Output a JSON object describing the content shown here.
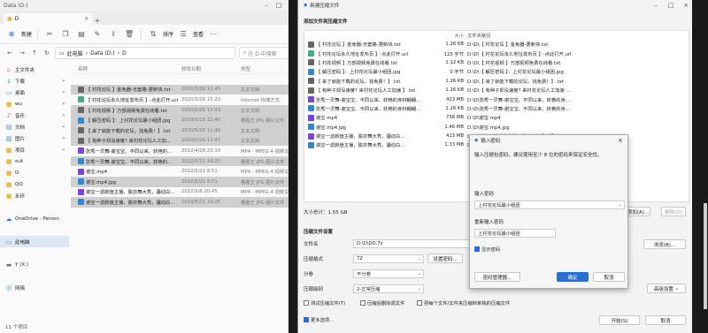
{
  "explorer": {
    "window_title": "Data (D:)",
    "tab_label": "D",
    "cmd": {
      "new": "新建",
      "sort": "排序",
      "view": "查看"
    },
    "address": {
      "parts": [
        "此电脑",
        "Data (D:)",
        "D"
      ],
      "search_placeholder": "在 D 中搜索"
    },
    "columns": {
      "name": "名称",
      "date": "修改日期",
      "type": "类型"
    },
    "nav": [
      {
        "label": "主文件夹",
        "icon": "home-icon",
        "sel": false,
        "indent": false,
        "pin": false
      },
      {
        "label": "下载",
        "icon": "download-icon",
        "sel": false,
        "indent": false,
        "pin": true
      },
      {
        "label": "桌面",
        "icon": "desktop-icon",
        "sel": false,
        "indent": false,
        "pin": true
      },
      {
        "label": "wu",
        "icon": "folder-icon",
        "sel": false,
        "indent": false,
        "pin": true
      },
      {
        "label": "音乐",
        "icon": "music-icon",
        "sel": false,
        "indent": false,
        "pin": true
      },
      {
        "label": "文档",
        "icon": "document-icon",
        "sel": false,
        "indent": false,
        "pin": true
      },
      {
        "label": "图片",
        "icon": "picture-icon",
        "sel": false,
        "indent": false,
        "pin": true
      },
      {
        "label": "项目",
        "icon": "folder-icon",
        "sel": false,
        "indent": false,
        "pin": true
      },
      {
        "label": "out",
        "icon": "folder-icon",
        "sel": false,
        "indent": false,
        "pin": false
      },
      {
        "label": "D",
        "icon": "folder-icon",
        "sel": false,
        "indent": false,
        "pin": false
      },
      {
        "label": "QQ",
        "icon": "folder-icon",
        "sel": false,
        "indent": false,
        "pin": false
      },
      {
        "label": "永环",
        "icon": "folder-icon",
        "sel": false,
        "indent": false,
        "pin": false
      },
      {
        "label": "",
        "icon": "",
        "sel": false,
        "indent": false,
        "pin": false
      },
      {
        "label": "OneDrive - Person",
        "icon": "cloud-icon",
        "sel": false,
        "indent": false,
        "pin": false
      },
      {
        "label": "",
        "icon": "",
        "sel": false,
        "indent": false,
        "pin": false
      },
      {
        "label": "此电脑",
        "icon": "computer-icon",
        "sel": true,
        "indent": false,
        "pin": false
      },
      {
        "label": "",
        "icon": "",
        "sel": false,
        "indent": false,
        "pin": false
      },
      {
        "label": "Y (X:)",
        "icon": "drive-icon",
        "sel": false,
        "indent": false,
        "pin": false
      },
      {
        "label": "",
        "icon": "",
        "sel": false,
        "indent": false,
        "pin": false
      },
      {
        "label": "网络",
        "icon": "network-icon",
        "sel": false,
        "indent": false,
        "pin": false
      }
    ],
    "files": [
      {
        "name": "",
        "date": "",
        "type": "",
        "color": "",
        "sel": false
      },
      {
        "name": "【 村花论坛 】金免器-无套路-更新快.txt",
        "date": "2020/5/26 11:45",
        "type": "文本文档",
        "color": "#666",
        "sel": true
      },
      {
        "name": "【 村花论坛永久地址发布页 】-点此打开.url",
        "date": "2020/5/26 15:23",
        "type": "Internet 快捷方式",
        "color": "#4a8",
        "sel": false
      },
      {
        "name": "【 村花视频 】万部视频免费在线看.txt",
        "date": "2020/5/26 11:43",
        "type": "文本文档",
        "color": "#666",
        "sel": true
      },
      {
        "name": "【 解压密码 】：上村花论坛最小组团.jpg",
        "date": "2019/5/15 22:46",
        "type": "看图王 JPG 图片文件",
        "color": "#38c",
        "sel": true
      },
      {
        "name": "【 来了就能下载的论坛，找免费！】.txt",
        "date": "2020/5/26 11:46",
        "type": "文本文档",
        "color": "#666",
        "sel": true
      },
      {
        "name": "【 有种子却没速度? 来村花论坛人工加...",
        "date": "2020/5/26 11:47",
        "type": "文本文档",
        "color": "#666",
        "sel": true
      },
      {
        "name": "张秀一灵舞-谢宝宝、不同以来、妖艳的...",
        "date": "2022/4/28 22:10",
        "type": "MP4 - MPEG-4 视频文件",
        "color": "#74d",
        "sel": false
      },
      {
        "name": "张秀一灵舞-谢宝宝、不同以来、妖艳的...",
        "date": "2022/5/21 16:25",
        "type": "看图王 JPG 图片文件",
        "color": "#38c",
        "sel": true
      },
      {
        "name": "谢宝.mp4",
        "date": "2022/5/21 8:51",
        "type": "MP4 - MPEG-4 视频文件",
        "color": "#74d",
        "sel": false
      },
      {
        "name": "谢宝.mp4.jpg",
        "date": "2022/5/21 8:51",
        "type": "看图王 JPG 图片文件",
        "color": "#38c",
        "sel": true
      },
      {
        "name": "谢宝一滤颜值主播，脱衣舞大秀，骚动白...",
        "date": "2022/5/8 20:45",
        "type": "MP4 - MPEG-4 视频文件",
        "color": "#74d",
        "sel": false
      },
      {
        "name": "谢宝一滤颜值主播，脱衣舞大秀，骚动白...",
        "date": "2022/5/21 16:25",
        "type": "看图王 JPG 图片文件",
        "color": "#38c",
        "sel": true
      }
    ],
    "status": "11 个项目"
  },
  "archive": {
    "window_title": "新建压缩文件",
    "section_add": "添加文件到压缩文件",
    "columns": {
      "name": "",
      "size": "大小",
      "path": "文件夹路径"
    },
    "files": [
      {
        "name": "【 村花论坛 】金免器-无套路-更新快.txt",
        "size": "1.26 KB",
        "path": "D:\\D\\【 村花论坛 】金免器-更新快.txt",
        "color": "#666"
      },
      {
        "name": "【 村花论坛永久地址发布页 】-点此打开.url",
        "size": "123 字节",
        "path": "D:\\D\\【 村花论坛永久地址发布页 】-点此打开.url",
        "color": "#4a8"
      },
      {
        "name": "【 村花视频 】万部视频免费在线看.txt",
        "size": "1.12 KB",
        "path": "D:\\D\\【 村花视频 】万部视频免费在线看.txt",
        "color": "#666"
      },
      {
        "name": "【 解压密码 】：上村花论坛最小组团.jpg",
        "size": "0 字节",
        "path": "D:\\D\\【 解压密码 】：上村花论坛最小组团.jpg",
        "color": "#38c"
      },
      {
        "name": "【 来了就能下载的论坛，找免费！】.txt",
        "size": "1.26 KB",
        "path": "D:\\D\\【 来了就能下载的论坛，找免费！】.txt",
        "color": "#666"
      },
      {
        "name": "【 有种子却没速度? 来村花论坛人工加速 】.txt",
        "size": "1.26 KB",
        "path": "D:\\D\\【 有种子却没速度? 来村花论坛人工加速 】.txt",
        "color": "#666"
      },
      {
        "name": "张秀一灵舞-谢宝宝、不同以来、妖艳的身材翩翩...",
        "size": "413 MB",
        "path": "D:\\D\\张秀一灵舞-谢宝宝、不同以来、妖艳的身材翩翩...",
        "color": "#74d"
      },
      {
        "name": "张秀一灵舞-谢宝宝、不同以来、妖艳的身材翩翩...",
        "size": "1.26 KB",
        "path": "D:\\D\\张秀一灵舞-谢宝宝、不同以来、妖艳的身材...",
        "color": "#38c"
      },
      {
        "name": "谢宝.mp4",
        "size": "736 MB",
        "path": "D:\\D\\谢宝.mp4",
        "color": "#74d"
      },
      {
        "name": "谢宝.mp4.jpg",
        "size": "1.46 MB",
        "path": "D:\\D\\谢宝.mp4.jpg",
        "color": "#38c"
      },
      {
        "name": "谢宝一滤颜值主播，脱衣舞大秀，骚动白...",
        "size": "413 MB",
        "path": "D:\\D\\谢宝一滤颜值主播，脱衣舞大秀，骚动白...",
        "color": "#74d"
      },
      {
        "name": "谢宝一滤颜值主播，脱衣舞大秀，骚动白...",
        "size": "1.33 MB",
        "path": "D:\\D\\谢宝一滤颜值主播，脱衣舞大秀，骚动白...",
        "color": "#38c"
      }
    ],
    "total_size": "大小总计：1.55 GB",
    "add_button": "添加(A)...",
    "delete_button": "删除(D)",
    "section_settings": "压缩文件设置",
    "filename_label": "文件名",
    "filename_value": "D:\\D\\DD.7z",
    "browse_button": "浏览(B)...",
    "format_label": "压缩格式",
    "format_value": "7Z",
    "set_password_button": "设置密码...",
    "split_label": "分卷",
    "split_value": "不分卷",
    "level_label": "压缩级别",
    "level_value": "2-正常压缩",
    "advanced_button": "高级设置",
    "options": [
      "测试压缩文件(T)",
      "压缩后删除源文件",
      "把每个文件/文件夹压缩到单独的压缩文件"
    ],
    "more_options": "更多选项...",
    "start_button": "开始(S)",
    "cancel_button": "取消"
  },
  "password": {
    "title": "输入密码",
    "desc": "输入压缩包密码。建议使用至少 8 位的密码来保证安全性。",
    "enter_label": "输入密码",
    "enter_value": "上村花论坛最小组团",
    "reenter_label": "重新输入密码",
    "reenter_value": "上村花论坛最小组团",
    "show_label": "显示密码",
    "manager_button": "密码管理器...",
    "ok_button": "确定",
    "cancel_button": "取消"
  }
}
